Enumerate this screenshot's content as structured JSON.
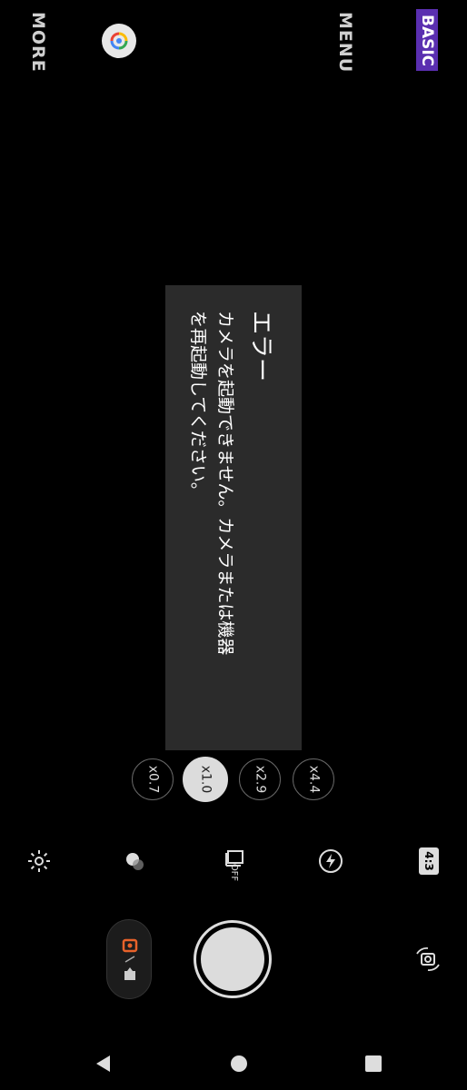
{
  "top": {
    "more_label": "MORE",
    "menu_label": "MENU",
    "basic_label": "BASIC"
  },
  "dialog": {
    "title": "エラー",
    "message_line1": "カメラを起動できません。カメラまたは機器",
    "message_line2": "を再起動してください。"
  },
  "zoom": [
    {
      "label": "x0.7",
      "active": false
    },
    {
      "label": "x1.0",
      "active": true
    },
    {
      "label": "x2.9",
      "active": false
    },
    {
      "label": "x4.4",
      "active": false
    }
  ],
  "controls": {
    "hdr_off_label": "OFF",
    "aspect_label": "4:3"
  },
  "colors": {
    "accent": "#5a2fb0",
    "record": "#e8622a",
    "background": "#000000",
    "dialog_bg": "#2b2b2b"
  }
}
